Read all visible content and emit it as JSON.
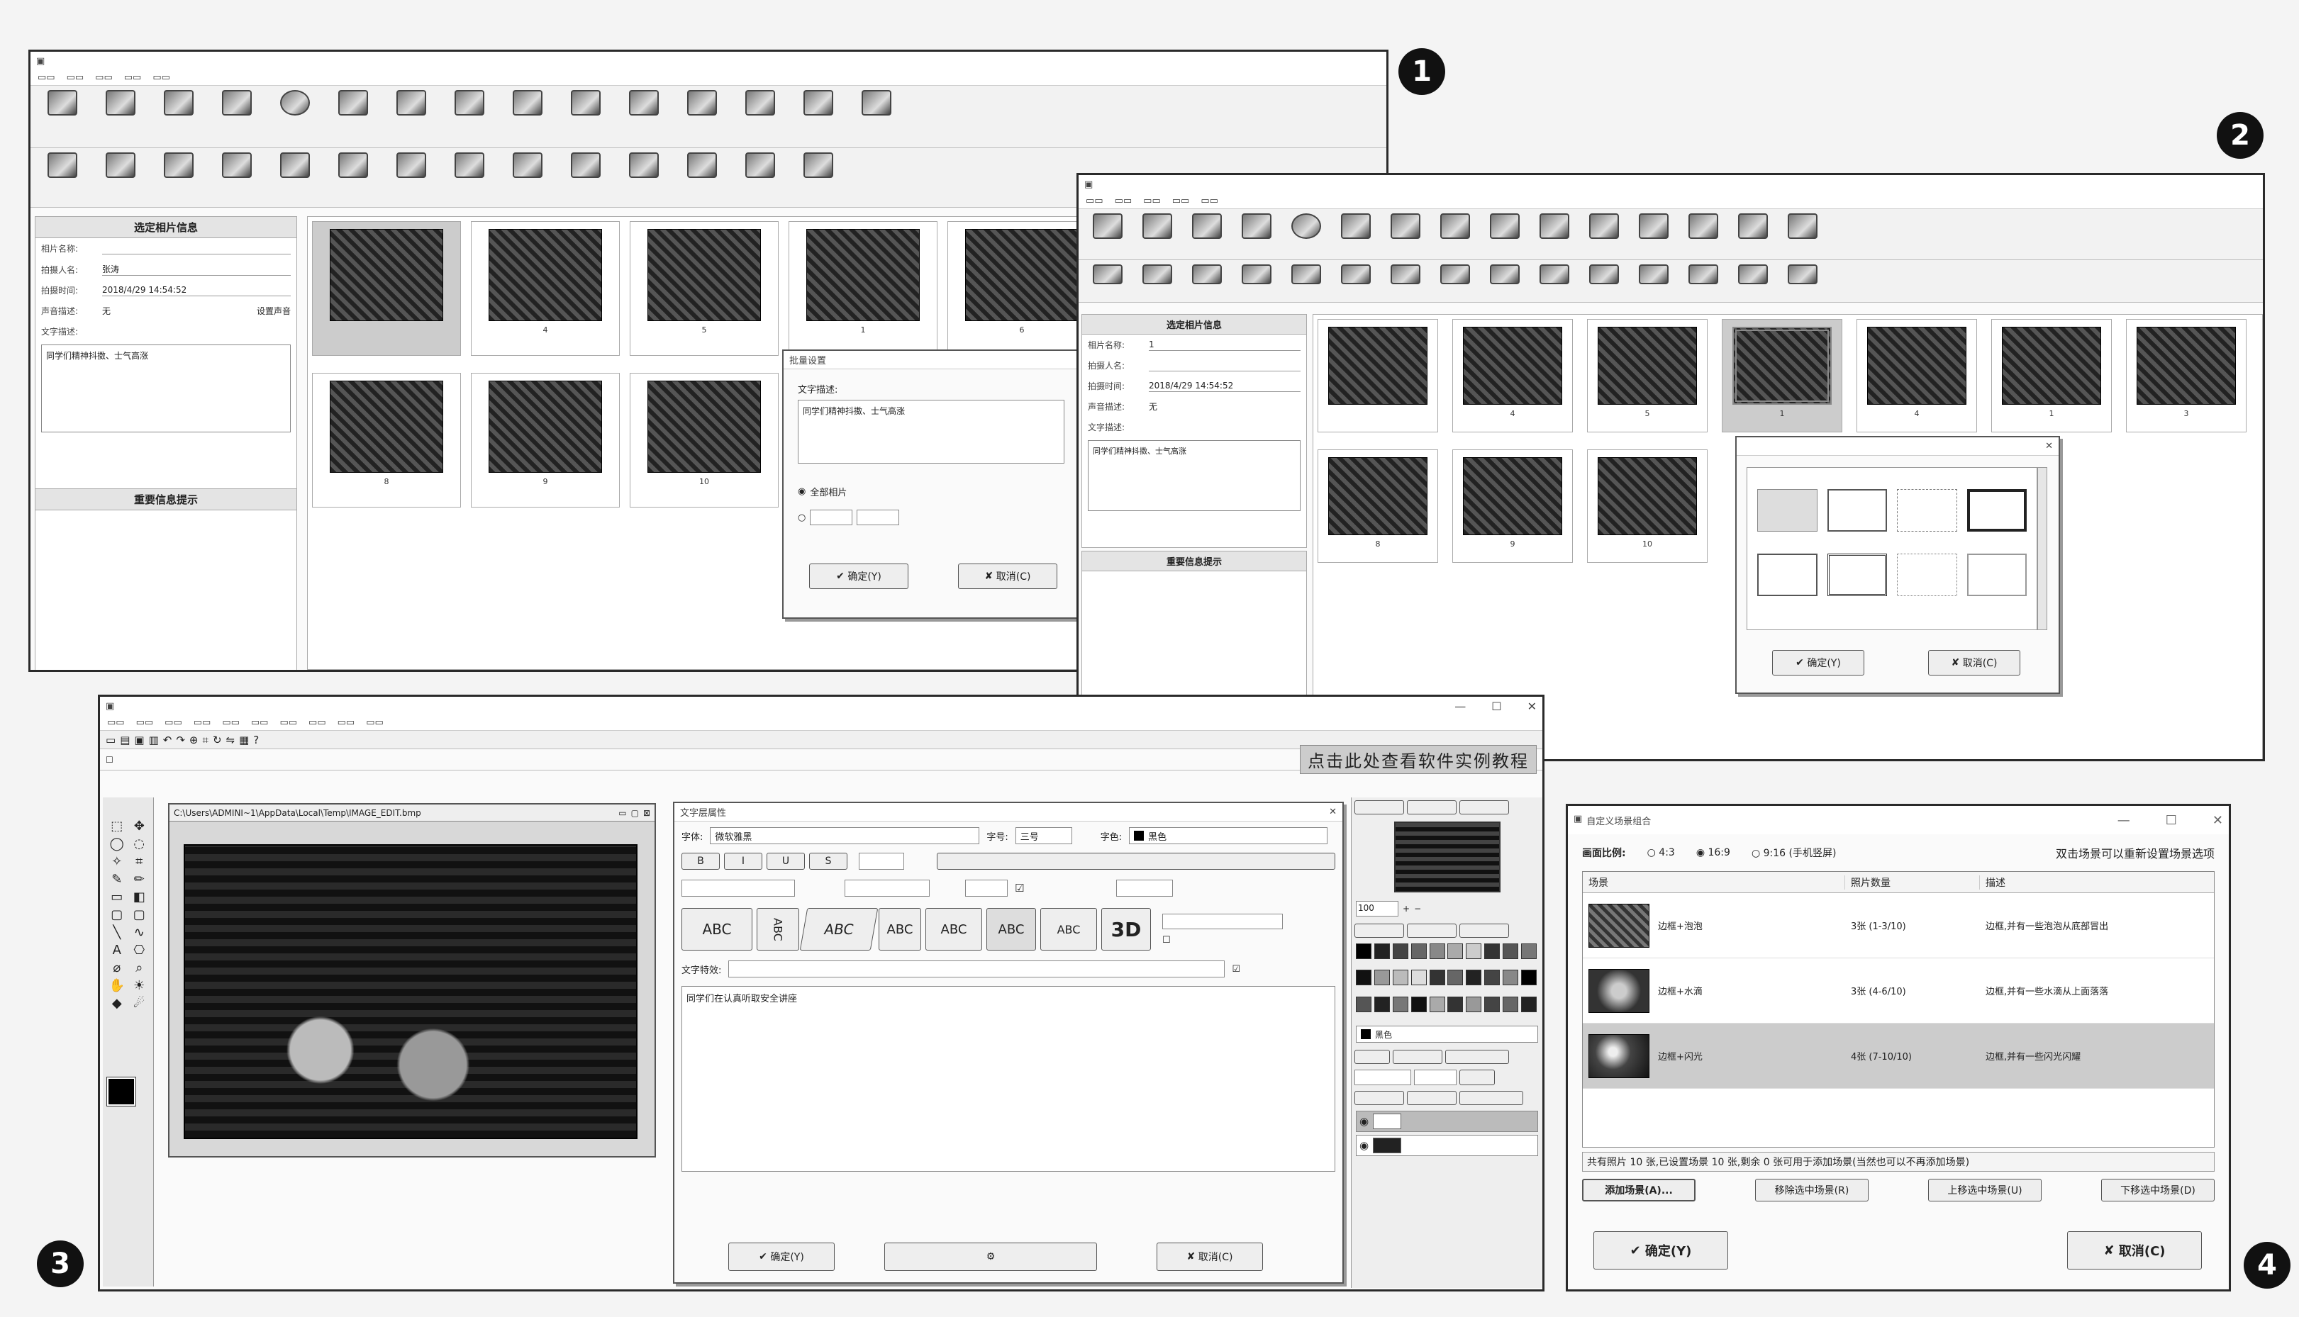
{
  "badges": {
    "b1": "1",
    "b2": "2",
    "b3": "3",
    "b4": "4"
  },
  "w1": {
    "title": "",
    "info_title": "选定相片信息",
    "fields": [
      {
        "label": "相片名称:",
        "value": ""
      },
      {
        "label": "拍摄人名:",
        "value": "张涛"
      },
      {
        "label": "拍摄时间:",
        "value": "2018/4/29 14:54:52"
      },
      {
        "label": "声音描述:",
        "value": "无"
      },
      {
        "label": "文字描述:",
        "value": ""
      }
    ],
    "sound_btn": "设置声音",
    "desc_text": "同学们精神抖擞、士气高涨",
    "notice_title": "重要信息提示",
    "hint_lines": [
      "",
      "",
      ""
    ],
    "captions": [
      "",
      "4",
      "5",
      "1",
      "6",
      "8",
      "9",
      "10"
    ],
    "dialog": {
      "title": "批量设置",
      "label": "文字描述:",
      "text": "同学们精神抖擞、士气高涨",
      "opt_all": "全部相片",
      "ok": "确定(Y)",
      "cancel": "取消(C)"
    }
  },
  "w2": {
    "title": "",
    "info_title": "选定相片信息",
    "fields": [
      {
        "label": "相片名称:",
        "value": "1"
      },
      {
        "label": "拍摄人名:",
        "value": ""
      },
      {
        "label": "拍摄时间:",
        "value": "2018/4/29 14:54:52"
      },
      {
        "label": "声音描述:",
        "value": "无"
      },
      {
        "label": "文字描述:",
        "value": ""
      }
    ],
    "desc_text": "同学们精神抖擞、士气高涨",
    "notice_title": "重要信息提示",
    "notices": [
      "",
      "",
      ""
    ],
    "captions": [
      "",
      "4",
      "5",
      "1",
      "4",
      "1",
      "3",
      "8",
      "9",
      "10"
    ],
    "dialog": {
      "title": "",
      "ok": "确定(Y)",
      "cancel": "取消(C)"
    }
  },
  "w3": {
    "title": "",
    "banner": "点击此处查看软件实例教程",
    "path": "C:\\Users\\ADMINI~1\\AppData\\Local\\Temp\\IMAGE_EDIT.bmp",
    "dialog": {
      "title": "文字层属性",
      "font_label": "字体:",
      "font": "微软雅黑",
      "size_label": "字号:",
      "size": "三号",
      "color_label": "字色:",
      "color": "黑色",
      "effect_label": "文字特效:",
      "text": "同学们在认真听取安全讲座",
      "ok": "确定(Y)",
      "cancel": "取消(C)"
    },
    "side": {
      "zoom": "100",
      "color_name": "黑色"
    }
  },
  "w4": {
    "title": "自定义场景组合",
    "ratio_label": "画面比例:",
    "ratio_opts": [
      "4:3",
      "16:9",
      "9:16 (手机竖屏)"
    ],
    "hint": "双击场景可以重新设置场景选项",
    "headers": [
      "场景",
      "照片数量",
      "描述"
    ],
    "rows": [
      {
        "scene": "边框+泡泡",
        "count": "3张 (1-3/10)",
        "desc": "边框,并有一些泡泡从底部冒出"
      },
      {
        "scene": "边框+水滴",
        "count": "3张 (4-6/10)",
        "desc": "边框,并有一些水滴从上面落落"
      },
      {
        "scene": "边框+闪光",
        "count": "4张 (7-10/10)",
        "desc": "边框,并有一些闪光闪耀"
      }
    ],
    "status": "共有照片 10 张,已设置场景 10 张,剩余 0 张可用于添加场景(当然也可以不再添加场景)",
    "buttons": [
      "添加场景(A)...",
      "移除选中场景(R)",
      "上移选中场景(U)",
      "下移选中场景(D)"
    ],
    "ok": "确定(Y)",
    "cancel": "取消(C)"
  }
}
